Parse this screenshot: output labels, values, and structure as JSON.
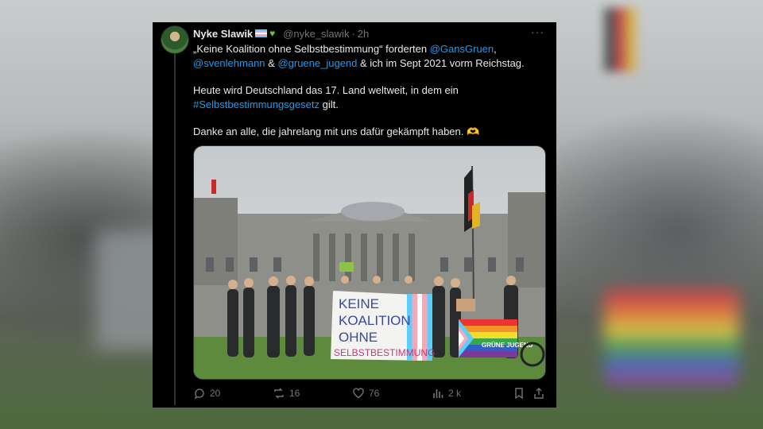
{
  "tweet": {
    "author_name": "Nyke Slawik",
    "author_handle": "@nyke_slawik",
    "separator": "·",
    "time": "2h",
    "more_label": "···",
    "line1_a": "„Keine Koalition ohne Selbstbestimmung“ forderten ",
    "mention1": "@GansGruen",
    "line1_b": ",",
    "mention2": "@svenlehmann",
    "amp": " & ",
    "mention3": "@gruene_jugend",
    "line2_b": " & ich im Sept 2021 vorm Reichstag.",
    "para2_a": "Heute wird Deutschland das 17. Land weltweit, in dem ein",
    "hashtag": "#Selbstbestimmungsgesetz",
    "para2_b": " gilt.",
    "para3": "Danke an alle, die jahrelang mit uns dafür gekämpft haben. 🫶",
    "media": {
      "banner_lines": [
        "KEINE",
        "KOALITION",
        "OHNE",
        "SELBSTBESTIMMUNG"
      ],
      "flag_label": "GRÜNE JUGEND"
    },
    "actions": {
      "replies": "20",
      "reposts": "16",
      "likes": "76",
      "views": "2 k"
    }
  },
  "colors": {
    "link": "#1d9bf0",
    "muted": "#71767b",
    "card_bg": "#000000"
  }
}
